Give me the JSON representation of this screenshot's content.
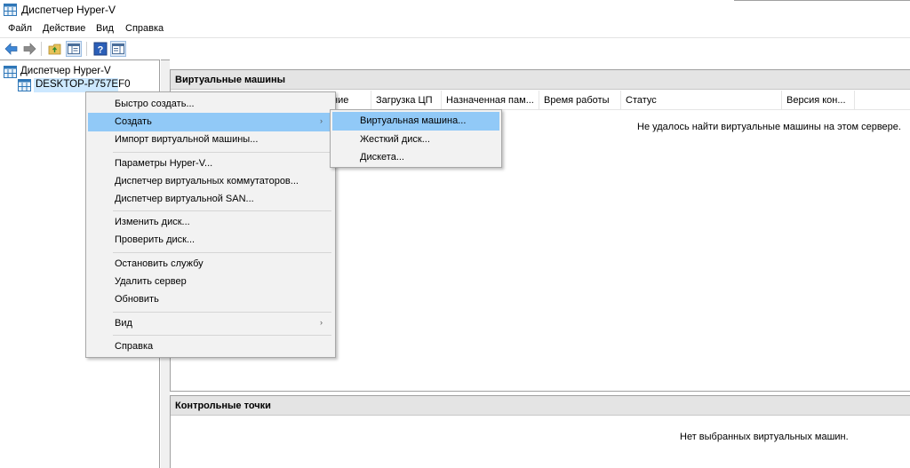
{
  "window": {
    "title": "Диспетчер Hyper-V"
  },
  "menubar": {
    "items": [
      "Файл",
      "Действие",
      "Вид",
      "Справка"
    ]
  },
  "toolbar": {
    "buttons": [
      "back-arrow-icon",
      "forward-arrow-icon",
      "up-folder-icon",
      "show-hide-tree-icon",
      "help-icon",
      "show-hide-action-pane-icon"
    ]
  },
  "tree": {
    "root_label": "Диспетчер Hyper-V",
    "server_label": "DESKTOP-P757EF0"
  },
  "main": {
    "vm_section_title": "Виртуальные машины",
    "columns": [
      "ние",
      "Загрузка ЦП",
      "Назначенная пам...",
      "Время работы",
      "Статус",
      "Версия кон..."
    ],
    "vm_empty_text": "Не удалось найти виртуальные машины на этом сервере.",
    "checkpoints_title": "Контрольные точки",
    "checkpoints_empty_text": "Нет выбранных виртуальных машин."
  },
  "context_menu": {
    "items": [
      {
        "label": "Быстро создать..."
      },
      {
        "label": "Создать",
        "submenu": true,
        "highlighted": true
      },
      {
        "label": "Импорт виртуальной машины..."
      },
      {
        "label": "Параметры Hyper-V..."
      },
      {
        "label": "Диспетчер виртуальных коммутаторов..."
      },
      {
        "label": "Диспетчер виртуальной SAN..."
      },
      {
        "label": "Изменить диск..."
      },
      {
        "label": "Проверить диск..."
      },
      {
        "label": "Остановить службу"
      },
      {
        "label": "Удалить сервер"
      },
      {
        "label": "Обновить"
      },
      {
        "label": "Вид",
        "submenu": true
      },
      {
        "label": "Справка"
      }
    ],
    "submenu_arrow": "›"
  },
  "submenu": {
    "items": [
      {
        "label": "Виртуальная машина...",
        "highlighted": true
      },
      {
        "label": "Жесткий диск..."
      },
      {
        "label": "Дискета..."
      }
    ]
  },
  "colors": {
    "highlight": "#91c9f7",
    "selection": "#cce8ff",
    "pane_header": "#e4e4e4",
    "menu_bg": "#f2f2f2"
  }
}
